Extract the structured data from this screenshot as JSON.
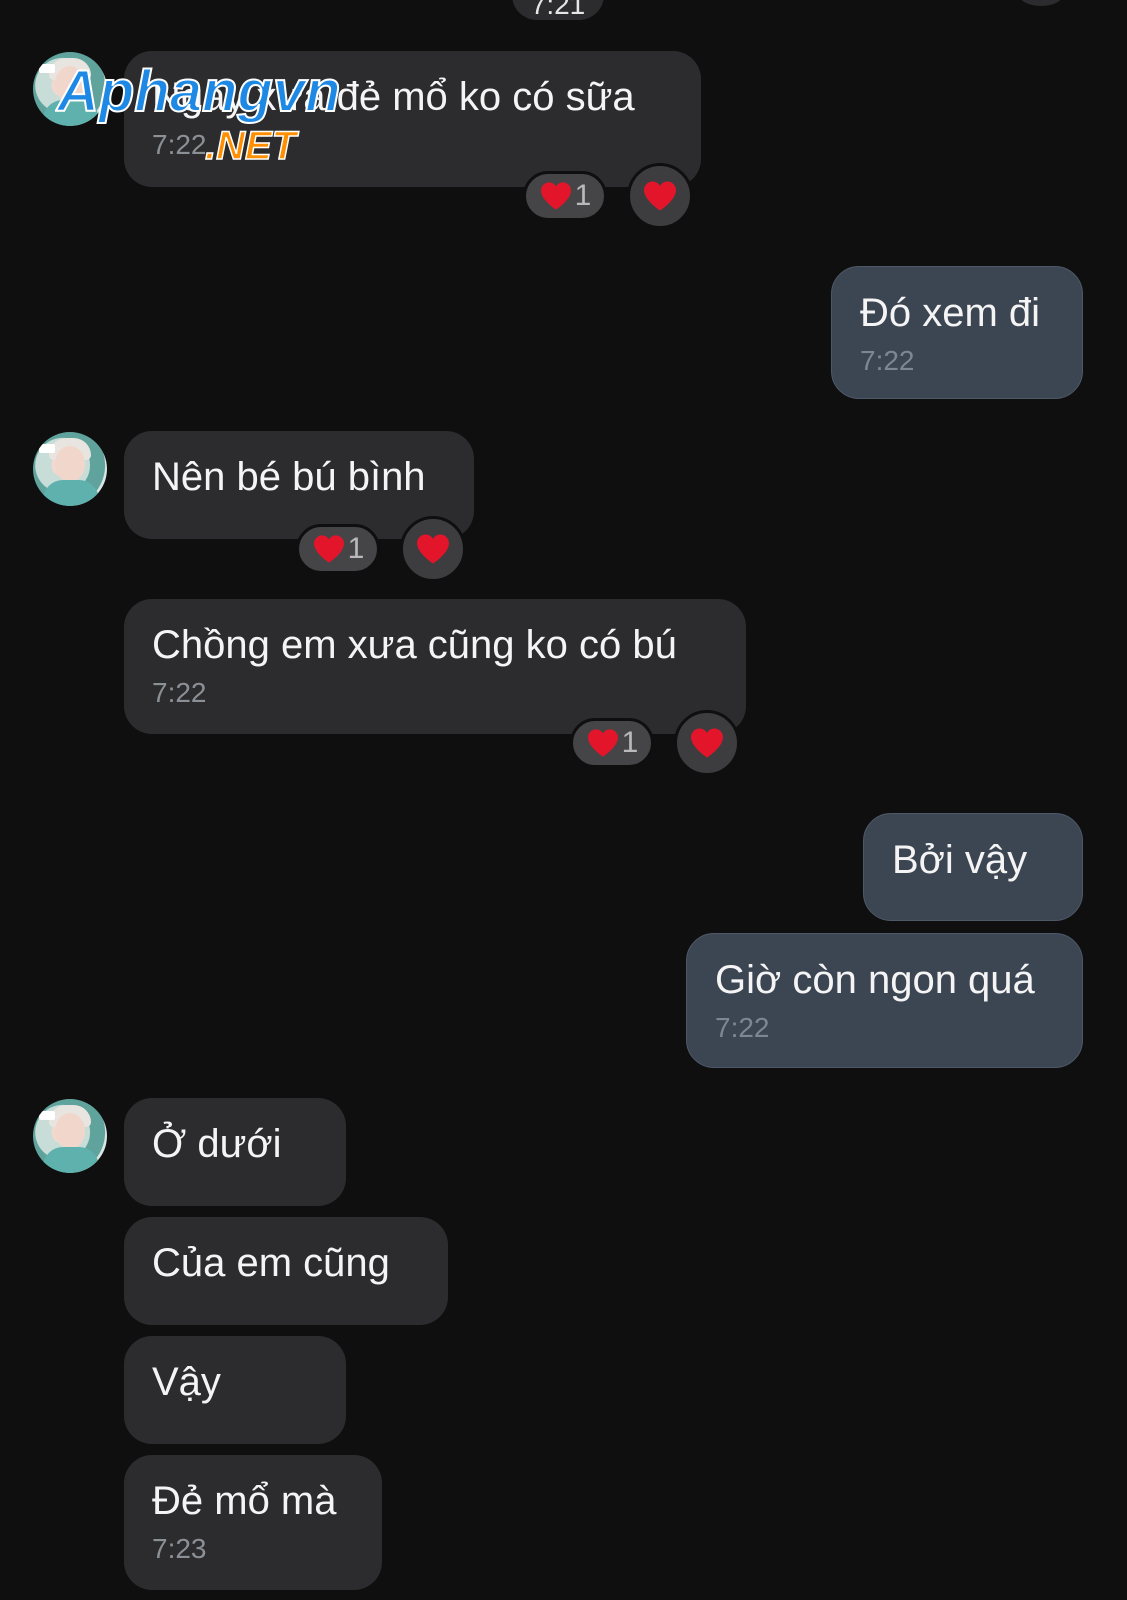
{
  "top": {
    "time_label": "7:21"
  },
  "watermark": {
    "line1": "Aphangvn",
    "line2": ".NET"
  },
  "messages": [
    {
      "text": "Ngày xưa đẻ mổ ko có sữa",
      "time": "7:22",
      "reaction_count": "1"
    },
    {
      "text": "Đó xem đi",
      "time": "7:22"
    },
    {
      "text": "Nên bé bú bình",
      "reaction_count": "1"
    },
    {
      "text": "Chồng em xưa cũng ko có bú",
      "time": "7:22",
      "reaction_count": "1"
    },
    {
      "text": "Bởi vậy"
    },
    {
      "text": "Giờ còn ngon quá",
      "time": "7:22"
    },
    {
      "text": "Ở dưới"
    },
    {
      "text": "Của em cũng"
    },
    {
      "text": "Vậy"
    },
    {
      "text": "Đẻ mổ mà",
      "time": "7:23"
    }
  ],
  "icons": {
    "reaction": "heart-icon",
    "avatar": "contact-avatar"
  },
  "colors": {
    "background": "#0f0f10",
    "incoming_bubble": "#2c2c2e",
    "outgoing_bubble": "#3c4552",
    "heart": "#e3152b"
  }
}
